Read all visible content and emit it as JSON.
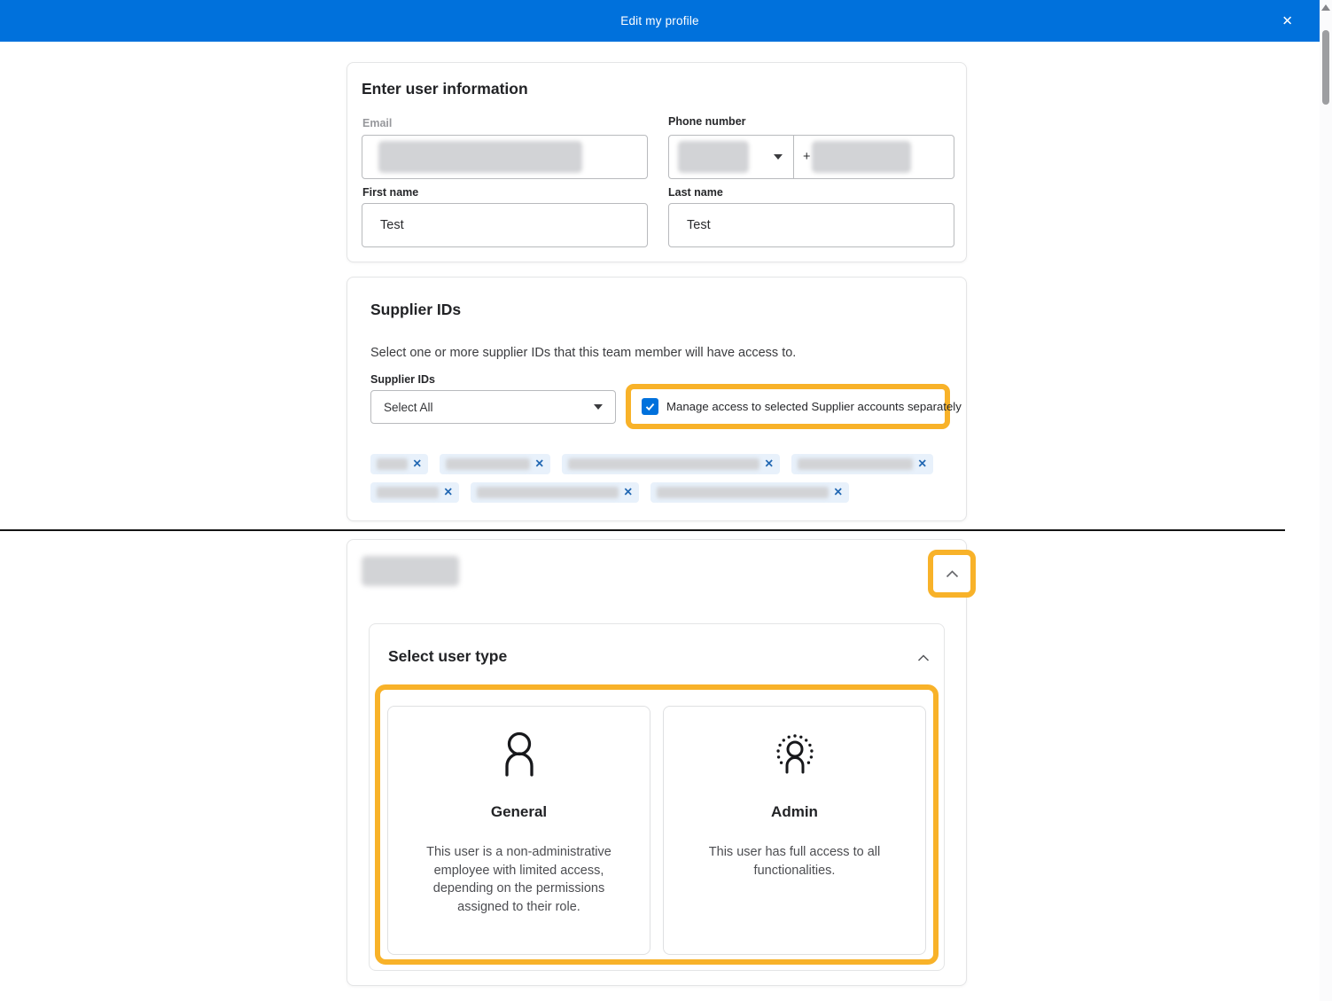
{
  "header": {
    "title": "Edit my profile"
  },
  "icons": {
    "close": "✕",
    "chip_remove": "✕"
  },
  "user_info": {
    "heading": "Enter user information",
    "email": {
      "label": "Email"
    },
    "phone": {
      "label": "Phone number",
      "prefix": "+"
    },
    "first_name": {
      "label": "First name",
      "value": "Test"
    },
    "last_name": {
      "label": "Last name",
      "value": "Test"
    }
  },
  "supplier_ids": {
    "heading": "Supplier IDs",
    "description": "Select one or more supplier IDs that this team member will have access to.",
    "select": {
      "label": "Supplier IDs",
      "value": "Select All"
    },
    "manage_access": {
      "label": "Manage access to selected Supplier accounts separately",
      "checked": true
    }
  },
  "user_type": {
    "heading": "Select user type",
    "options": [
      {
        "label": "General",
        "description": "This user is a non-administrative employee with limited access, depending on the permissions assigned to their role."
      },
      {
        "label": "Admin",
        "description": "This user has full access to all functionalities."
      }
    ]
  },
  "colors": {
    "header_blue": "#0071dc",
    "highlight_yellow": "#f8b229",
    "chip_background": "#e8f1fb",
    "checkbox_blue": "#0071dc"
  }
}
